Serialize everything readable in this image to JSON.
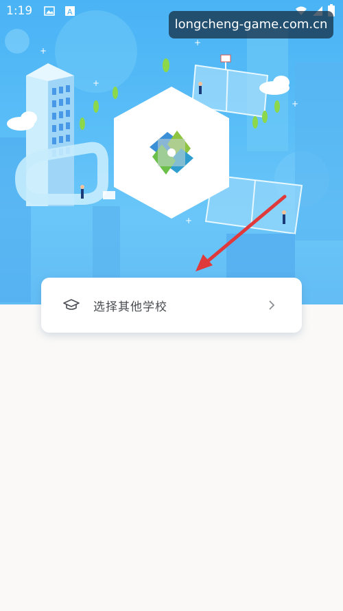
{
  "status_bar": {
    "time": "1:19"
  },
  "watermark": {
    "text": "longcheng-game.com.cn"
  },
  "school_select": {
    "label": "选择其他学校"
  },
  "colors": {
    "hero_blue": "#4ab3f5",
    "arrow_red": "#e0393b",
    "card_text": "#4a4d52",
    "background": "#faf9f7"
  },
  "icons": {
    "cap": "graduation-cap-icon",
    "chevron": "chevron-right-icon",
    "logo": "app-logo"
  }
}
